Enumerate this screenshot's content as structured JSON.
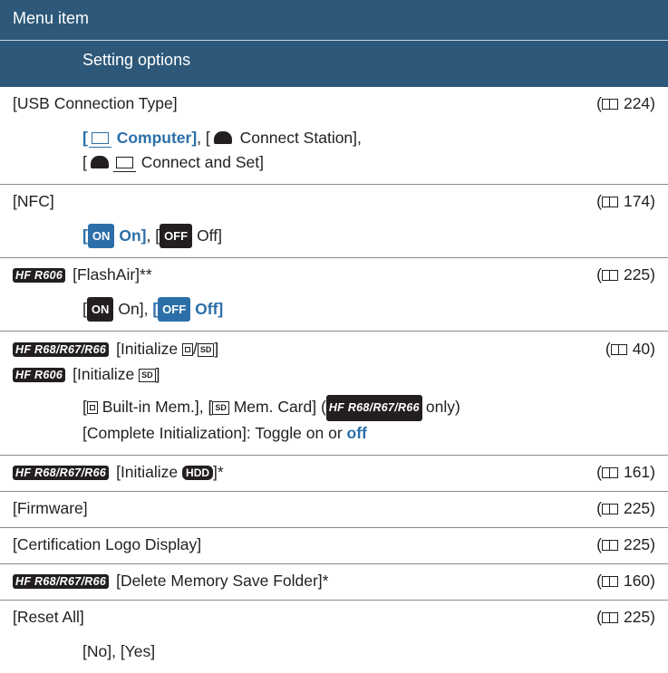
{
  "header": {
    "col1": "Menu item",
    "col2": "Setting options"
  },
  "refs": {
    "usb": "224",
    "nfc": "174",
    "flashair": "225",
    "initialize": "40",
    "init_hdd": "161",
    "firmware": "225",
    "certification": "225",
    "delete_folder": "160",
    "reset": "225"
  },
  "models": {
    "r606": "HF R606",
    "r68": "HF R68/R67/R66"
  },
  "usb": {
    "label": "[USB Connection Type]",
    "opt1_open": "[",
    "opt1_text": "Computer]",
    "sep1": ", [",
    "opt2_text": "Connect Station],",
    "opt3_open": "[",
    "opt3_text": "Connect and Set]"
  },
  "nfc": {
    "label": "[NFC]",
    "opt1_open": "[",
    "on_badge": "ON",
    "opt1_text": "On]",
    "sep": ", [",
    "off_badge": "OFF",
    "opt2_text": "Off]"
  },
  "flashair": {
    "label": "[FlashAir]**",
    "opt1_open": "[",
    "on_badge": "ON",
    "opt1_text": "On], ",
    "opt2_open": "[",
    "off_badge": "OFF",
    "opt2_text": "Off]"
  },
  "initialize": {
    "label1_pre": "[Initialize ",
    "slash": "/",
    "label1_post": "]",
    "label2_pre": "[Initialize ",
    "label2_post": "]",
    "sd_icon": "SD",
    "opt_open": "[",
    "opt_builtin": "Built-in Mem.], [",
    "opt_card": "Mem. Card] (",
    "opt_only": "only)",
    "opt_complete": "[Complete Initialization]: Toggle on or ",
    "opt_off": "off"
  },
  "init_hdd": {
    "label_pre": "[Initialize ",
    "hdd_icon": "HDD",
    "label_post": "]*"
  },
  "firmware": {
    "label": "[Firmware]"
  },
  "certification": {
    "label": "[Certification Logo Display]"
  },
  "delete_folder": {
    "label": "[Delete Memory Save Folder]*"
  },
  "reset": {
    "label": "[Reset All]",
    "options": "[No], [Yes]"
  },
  "colors": {
    "header_bg": "#2d5879",
    "accent_blue": "#2c6fa8"
  },
  "icons": {
    "ref": "book-icon",
    "computer": "computer-icon",
    "station": "connect-station-icon"
  }
}
